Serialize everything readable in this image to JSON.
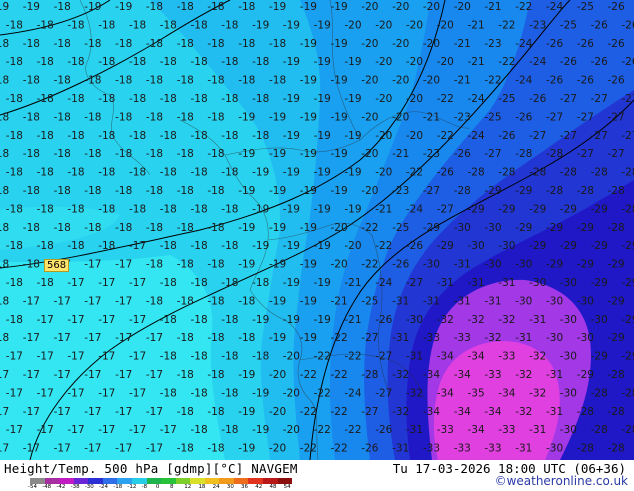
{
  "map": {
    "title": "Height/Temp. 500 hPa [gdmp][°C] NAVGEM",
    "valid": "Tu 17-03-2026 18:00 UTC (06+36)",
    "credit": "©weatheronline.co.uk",
    "height_label": "568",
    "colorbar_ticks": [
      "-54",
      "-48",
      "-42",
      "-38",
      "-30",
      "-24",
      "-18",
      "-12",
      "-8",
      "0",
      "8",
      "12",
      "18",
      "24",
      "30",
      "36",
      "42",
      "48",
      "54"
    ],
    "colorbar_colors": [
      "#8a8a8a",
      "#a52ea0",
      "#c21bc4",
      "#6a26d6",
      "#2a2fd6",
      "#2e6ee8",
      "#2aa2f0",
      "#25cde6",
      "#1fb34d",
      "#28c23a",
      "#7ccf2a",
      "#d8e02a",
      "#f0c020",
      "#f29a1c",
      "#ee6d1c",
      "#e0321c",
      "#b81818",
      "#8a1010"
    ],
    "field_colors": {
      "t_m17": "#33e6f2",
      "t_m18": "#29d3ef",
      "t_m19": "#21bdf0",
      "t_m20": "#1aa0f0",
      "t_m21": "#1888ee",
      "t_m24": "#1d5ee4",
      "t_m27": "#2236d4",
      "t_m30": "#2018c6",
      "t_m33": "#a238e6",
      "t_m34": "#e040e0"
    },
    "rows": [
      [
        "-19",
        "-19",
        "-18",
        "-19",
        "-19",
        "-18",
        "-18",
        "-18",
        "-18",
        "-19",
        "-19",
        "-19",
        "-20",
        "-20",
        "-20",
        "-20",
        "-21",
        "-22",
        "-24",
        "-25",
        "-26"
      ],
      [
        "-18",
        "-18",
        "-18",
        "-18",
        "-18",
        "-18",
        "-18",
        "-18",
        "-19",
        "-19",
        "-19",
        "-20",
        "-20",
        "-20",
        "-20",
        "-21",
        "-22",
        "-23",
        "-25",
        "-26",
        "-26"
      ],
      [
        "-18",
        "-18",
        "-18",
        "-18",
        "-18",
        "-18",
        "-18",
        "-18",
        "-18",
        "-18",
        "-19",
        "-19",
        "-20",
        "-20",
        "-20",
        "-21",
        "-23",
        "-24",
        "-26",
        "-26",
        "-26"
      ],
      [
        "-18",
        "-18",
        "-18",
        "-18",
        "-18",
        "-18",
        "-18",
        "-18",
        "-18",
        "-19",
        "-19",
        "-19",
        "-20",
        "-20",
        "-20",
        "-21",
        "-22",
        "-24",
        "-26",
        "-26",
        "-26"
      ],
      [
        "-18",
        "-18",
        "-18",
        "-18",
        "-18",
        "-18",
        "-18",
        "-18",
        "-18",
        "-18",
        "-19",
        "-19",
        "-20",
        "-20",
        "-20",
        "-21",
        "-22",
        "-24",
        "-26",
        "-26",
        "-26"
      ],
      [
        "-18",
        "-18",
        "-18",
        "-18",
        "-18",
        "-18",
        "-18",
        "-18",
        "-18",
        "-19",
        "-19",
        "-19",
        "-20",
        "-20",
        "-22",
        "-24",
        "-25",
        "-26",
        "-27",
        "-27",
        "-27"
      ],
      [
        "-18",
        "-18",
        "-18",
        "-18",
        "-18",
        "-18",
        "-18",
        "-18",
        "-19",
        "-19",
        "-19",
        "-19",
        "-20",
        "-20",
        "-21",
        "-23",
        "-25",
        "-26",
        "-27",
        "-27",
        "-27"
      ],
      [
        "-18",
        "-18",
        "-18",
        "-18",
        "-18",
        "-18",
        "-18",
        "-18",
        "-18",
        "-19",
        "-19",
        "-19",
        "-20",
        "-20",
        "-22",
        "-24",
        "-26",
        "-27",
        "-27",
        "-27",
        "-27"
      ],
      [
        "-18",
        "-18",
        "-18",
        "-18",
        "-18",
        "-18",
        "-18",
        "-18",
        "-19",
        "-19",
        "-19",
        "-19",
        "-20",
        "-21",
        "-23",
        "-26",
        "-27",
        "-28",
        "-28",
        "-27",
        "-27"
      ],
      [
        "-18",
        "-18",
        "-18",
        "-18",
        "-18",
        "-18",
        "-18",
        "-18",
        "-19",
        "-19",
        "-19",
        "-19",
        "-20",
        "-22",
        "-26",
        "-28",
        "-28",
        "-28",
        "-28",
        "-28",
        "-28"
      ],
      [
        "-18",
        "-18",
        "-18",
        "-18",
        "-18",
        "-18",
        "-18",
        "-18",
        "-19",
        "-19",
        "-19",
        "-19",
        "-20",
        "-23",
        "-27",
        "-28",
        "-29",
        "-29",
        "-28",
        "-28",
        "-28"
      ],
      [
        "-18",
        "-18",
        "-18",
        "-18",
        "-18",
        "-18",
        "-18",
        "-18",
        "-19",
        "-19",
        "-19",
        "-19",
        "-21",
        "-24",
        "-27",
        "-29",
        "-29",
        "-29",
        "-29",
        "-29",
        "-28"
      ],
      [
        "-18",
        "-18",
        "-18",
        "-18",
        "-18",
        "-18",
        "-18",
        "-18",
        "-19",
        "-19",
        "-19",
        "-20",
        "-22",
        "-25",
        "-29",
        "-30",
        "-30",
        "-29",
        "-29",
        "-29",
        "-28"
      ],
      [
        "-18",
        "-18",
        "-18",
        "-18",
        "-17",
        "-18",
        "-18",
        "-18",
        "-19",
        "-19",
        "-19",
        "-20",
        "-22",
        "-26",
        "-29",
        "-30",
        "-30",
        "-29",
        "-29",
        "-29",
        "-29"
      ],
      [
        "-18",
        "-18",
        "-17",
        "-17",
        "-17",
        "-18",
        "-18",
        "-18",
        "-19",
        "-19",
        "-19",
        "-20",
        "-22",
        "-26",
        "-30",
        "-31",
        "-30",
        "-30",
        "-29",
        "-29",
        "-29"
      ],
      [
        "-18",
        "-18",
        "-17",
        "-17",
        "-17",
        "-18",
        "-18",
        "-18",
        "-18",
        "-19",
        "-19",
        "-21",
        "-24",
        "-27",
        "-31",
        "-31",
        "-31",
        "-30",
        "-30",
        "-29",
        "-29"
      ],
      [
        "-18",
        "-17",
        "-17",
        "-17",
        "-17",
        "-18",
        "-18",
        "-18",
        "-18",
        "-19",
        "-19",
        "-21",
        "-25",
        "-31",
        "-31",
        "-31",
        "-31",
        "-30",
        "-30",
        "-30",
        "-29"
      ],
      [
        "-18",
        "-17",
        "-17",
        "-17",
        "-17",
        "-18",
        "-18",
        "-18",
        "-19",
        "-19",
        "-19",
        "-21",
        "-26",
        "-30",
        "-32",
        "-32",
        "-32",
        "-31",
        "-30",
        "-30",
        "-29"
      ],
      [
        "-18",
        "-17",
        "-17",
        "-17",
        "-17",
        "-17",
        "-18",
        "-18",
        "-18",
        "-19",
        "-19",
        "-22",
        "-27",
        "-31",
        "-33",
        "-33",
        "-32",
        "-31",
        "-30",
        "-30",
        "-29"
      ],
      [
        "-17",
        "-17",
        "-17",
        "-17",
        "-17",
        "-18",
        "-18",
        "-18",
        "-18",
        "-20",
        "-22",
        "-22",
        "-27",
        "-31",
        "-34",
        "-34",
        "-33",
        "-32",
        "-30",
        "-29",
        "-29"
      ],
      [
        "-17",
        "-17",
        "-17",
        "-17",
        "-17",
        "-17",
        "-18",
        "-18",
        "-19",
        "-20",
        "-22",
        "-22",
        "-28",
        "-32",
        "-34",
        "-34",
        "-33",
        "-32",
        "-31",
        "-29",
        "-28"
      ],
      [
        "-17",
        "-17",
        "-17",
        "-17",
        "-17",
        "-18",
        "-18",
        "-18",
        "-19",
        "-20",
        "-22",
        "-24",
        "-27",
        "-32",
        "-34",
        "-35",
        "-34",
        "-32",
        "-30",
        "-28",
        "-28"
      ],
      [
        "-17",
        "-17",
        "-17",
        "-17",
        "-17",
        "-17",
        "-18",
        "-18",
        "-19",
        "-20",
        "-22",
        "-22",
        "-27",
        "-32",
        "-34",
        "-34",
        "-34",
        "-32",
        "-31",
        "-28",
        "-28"
      ],
      [
        "-17",
        "-17",
        "-17",
        "-17",
        "-17",
        "-17",
        "-18",
        "-18",
        "-19",
        "-20",
        "-22",
        "-22",
        "-26",
        "-31",
        "-33",
        "-34",
        "-33",
        "-31",
        "-30",
        "-28",
        "-28"
      ],
      [
        "-17",
        "-17",
        "-17",
        "-17",
        "-17",
        "-17",
        "-18",
        "-18",
        "-19",
        "-20",
        "-22",
        "-22",
        "-26",
        "-31",
        "-33",
        "-33",
        "-33",
        "-31",
        "-30",
        "-28",
        "-28"
      ]
    ]
  }
}
